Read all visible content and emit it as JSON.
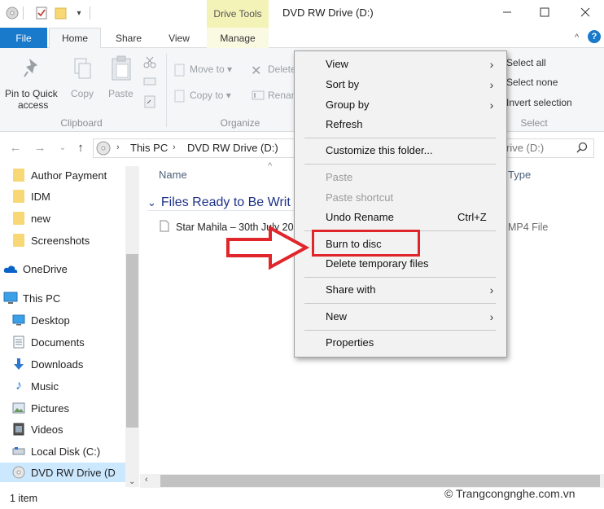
{
  "window": {
    "contextual_tab": "Drive Tools",
    "title": "DVD RW Drive (D:)"
  },
  "tabs": [
    "File",
    "Home",
    "Share",
    "View",
    "Manage"
  ],
  "ribbon": {
    "clipboard": {
      "pin_label_line1": "Pin to Quick",
      "pin_label_line2": "access",
      "copy": "Copy",
      "paste": "Paste",
      "group": "Clipboard"
    },
    "organize": {
      "move_to": "Move to",
      "copy_to": "Copy to",
      "delete": "Delete",
      "rename": "Renam",
      "group": "Organize"
    },
    "select": {
      "select_all": "Select all",
      "select_none": "Select none",
      "invert": "Invert selection",
      "group": "Select"
    }
  },
  "address": {
    "this_pc": "This PC",
    "drive": "DVD RW Drive (D:)",
    "search_text": "rive (D:)"
  },
  "nav": {
    "items": [
      {
        "label": "Author Payment",
        "icon": "folder-icon"
      },
      {
        "label": "IDM",
        "icon": "folder-icon"
      },
      {
        "label": "new",
        "icon": "folder-icon"
      },
      {
        "label": "Screenshots",
        "icon": "folder-icon"
      },
      {
        "label": "OneDrive",
        "icon": "cloud-icon"
      },
      {
        "label": "This PC",
        "icon": "computer-icon"
      },
      {
        "label": "Desktop",
        "icon": "desktop-icon"
      },
      {
        "label": "Documents",
        "icon": "documents-icon"
      },
      {
        "label": "Downloads",
        "icon": "download-icon"
      },
      {
        "label": "Music",
        "icon": "music-icon"
      },
      {
        "label": "Pictures",
        "icon": "pictures-icon"
      },
      {
        "label": "Videos",
        "icon": "videos-icon"
      },
      {
        "label": "Local Disk (C:)",
        "icon": "disk-icon"
      },
      {
        "label": "DVD RW Drive (D",
        "icon": "dvd-icon"
      }
    ]
  },
  "content": {
    "col_name": "Name",
    "col_type": "Type",
    "group_header": "Files Ready to Be Writ",
    "file_name": "Star Mahila – 30th July 20",
    "file_type": "MP4 File"
  },
  "status": {
    "item_count": "1 item"
  },
  "watermark": "© Trangcongnghe.com.vn",
  "context_menu": {
    "view": "View",
    "sort_by": "Sort by",
    "group_by": "Group by",
    "refresh": "Refresh",
    "customize": "Customize this folder...",
    "paste": "Paste",
    "paste_shortcut": "Paste shortcut",
    "undo_rename": "Undo Rename",
    "undo_shortcut": "Ctrl+Z",
    "burn": "Burn to disc",
    "delete_temp": "Delete temporary files",
    "share_with": "Share with",
    "new": "New",
    "properties": "Properties"
  },
  "colors": {
    "file_tab": "#1979ca",
    "drive_tools": "#f3f3b8",
    "highlight_box": "#e0262b",
    "selection": "#cce8ff"
  }
}
